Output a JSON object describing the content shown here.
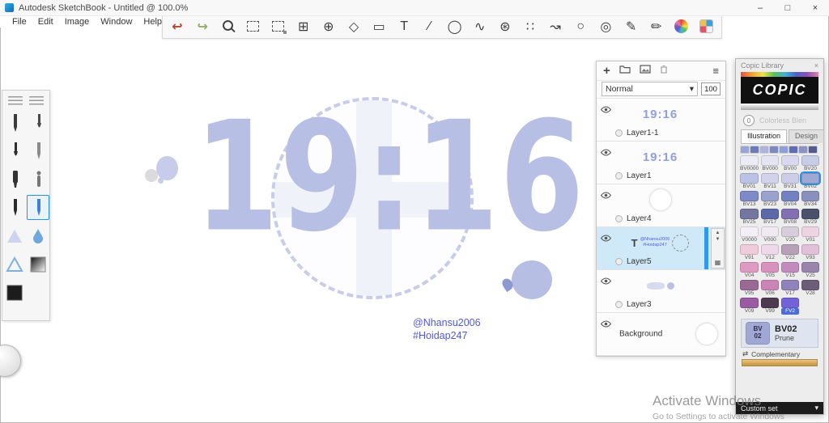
{
  "ui": {
    "caret": "▾",
    "menu_icon": "≡",
    "plus_icon": "+",
    "up_arrow": "▲",
    "down_arrow": "▼",
    "alpha_lock_icon": "▦",
    "complementary_icon": "⇄"
  },
  "window": {
    "title": "Autodesk SketchBook - Untitled @ 100.0%",
    "minimize": "–",
    "maximize": "□",
    "close": "×"
  },
  "menubar": {
    "items": [
      "File",
      "Edit",
      "Image",
      "Window",
      "Help"
    ]
  },
  "toolbar": {
    "tools": [
      {
        "name": "undo-icon",
        "glyph": "↩",
        "color": "#b5432f"
      },
      {
        "name": "redo-icon",
        "glyph": "↪",
        "color": "#8fae62"
      },
      {
        "name": "zoom-icon",
        "css": "zoom"
      },
      {
        "name": "rect-select-icon",
        "css": "dashbox"
      },
      {
        "name": "magic-select-icon",
        "css": "dashbox dot"
      },
      {
        "name": "crop-icon",
        "glyph": "⊞"
      },
      {
        "name": "transform-icon",
        "glyph": "⊕"
      },
      {
        "name": "polygon-select-icon",
        "glyph": "◇"
      },
      {
        "name": "distort-icon",
        "glyph": "▭"
      },
      {
        "name": "text-tool-icon",
        "glyph": "T"
      },
      {
        "name": "ruler-icon",
        "glyph": "∕"
      },
      {
        "name": "ellipse-guide-icon",
        "glyph": "◯"
      },
      {
        "name": "french-curve-icon",
        "glyph": "∿"
      },
      {
        "name": "perspective-icon",
        "glyph": "⊛"
      },
      {
        "name": "symmetry-icon",
        "glyph": "∷"
      },
      {
        "name": "steady-stroke-icon",
        "glyph": "↝"
      },
      {
        "name": "circle-tool-icon",
        "glyph": "○"
      },
      {
        "name": "ellipse-tool-icon",
        "glyph": "◎"
      },
      {
        "name": "pencil-set-icon",
        "glyph": "✎"
      },
      {
        "name": "brush-set-icon",
        "glyph": "✏"
      },
      {
        "name": "color-wheel-icon",
        "css": "colorwheel"
      },
      {
        "name": "swatch-grid-icon",
        "css": "swatchgrid"
      }
    ]
  },
  "brush_palette": {
    "brushes": [
      {
        "name": "pencil-brush",
        "shape": "pencil",
        "color": "#3b3b3b"
      },
      {
        "name": "paintbrush-brush",
        "shape": "brush",
        "color": "#4a4a4a"
      },
      {
        "name": "ink-brush",
        "shape": "brush",
        "color": "#2e2e2e"
      },
      {
        "name": "ballpoint-pen-brush",
        "shape": "pen",
        "color": "#8a8a8a"
      },
      {
        "name": "marker-brush",
        "shape": "marker",
        "color": "#333333"
      },
      {
        "name": "airbrush-brush",
        "shape": "airbrush",
        "color": "#777777"
      },
      {
        "name": "technical-pen-brush",
        "shape": "pen",
        "color": "#2b2b2b"
      },
      {
        "name": "glow-pen-brush",
        "shape": "pen",
        "color": "#3f7fd6",
        "selected": true
      },
      {
        "name": "smudge-brush",
        "shape": "triangle",
        "color": "#cdd5ee"
      },
      {
        "name": "water-drop-brush",
        "shape": "droplet",
        "color": "#6fa8dc"
      },
      {
        "name": "smear-brush",
        "shape": "triangleOutline",
        "color": "#7fb0e0"
      },
      {
        "name": "gradient-fill-tool",
        "shape": "gradient",
        "color": "#444444"
      },
      {
        "name": "solid-fill-tool",
        "shape": "square",
        "color": "#1c1c1c"
      }
    ]
  },
  "canvas": {
    "time_text": "19:16",
    "credit_line1": "@Nhansu2006",
    "credit_line2": "#Hoidap247"
  },
  "layers_panel": {
    "blend_mode": "Normal",
    "opacity": "100",
    "time_thumb_text": "19:16",
    "text_thumb_lines": [
      "@Nhansu2006",
      "#Hoidap247"
    ],
    "layers": [
      {
        "name": "Layer1-1",
        "thumb": "time"
      },
      {
        "name": "Layer1",
        "thumb": "time"
      },
      {
        "name": "Layer4",
        "thumb": "circle"
      },
      {
        "name": "Layer5",
        "thumb": "text",
        "selected": true
      },
      {
        "name": "Layer3",
        "thumb": "marks"
      },
      {
        "name": "Background",
        "thumb": "bgcircle"
      }
    ]
  },
  "copic_panel": {
    "title": "Copic Library",
    "close": "×",
    "logo": "COPIC",
    "colorless": {
      "number": "0",
      "label": "Colorless Blen"
    },
    "tabs": [
      {
        "label": "Illustration",
        "active": true
      },
      {
        "label": "Design",
        "active": false
      }
    ],
    "family_strip": [
      "#97a5d8",
      "#6e79b5",
      "#aab4de",
      "#7d88c0",
      "#8d9fd6",
      "#5f6db0",
      "#8a93c4",
      "#525c8e"
    ],
    "swatches": [
      {
        "code": "BV0000",
        "color": "#ececf6"
      },
      {
        "code": "BV000",
        "color": "#e5e4f2"
      },
      {
        "code": "BV00",
        "color": "#dad8ee"
      },
      {
        "code": "BV20",
        "color": "#c7cde6"
      },
      {
        "code": "BV01",
        "color": "#bcc2e4"
      },
      {
        "code": "BV11",
        "color": "#d2d2ea"
      },
      {
        "code": "BV31",
        "color": "#cccee8"
      },
      {
        "code": "BV02",
        "color": "#9fa7d5",
        "selected": true
      },
      {
        "code": "BV13",
        "color": "#7e8ac7"
      },
      {
        "code": "BV23",
        "color": "#99a2cd"
      },
      {
        "code": "BV04",
        "color": "#7381c0"
      },
      {
        "code": "BV34",
        "color": "#8a90bc"
      },
      {
        "code": "BV25",
        "color": "#73769f"
      },
      {
        "code": "BV17",
        "color": "#5d68aa"
      },
      {
        "code": "BV08",
        "color": "#8370b3"
      },
      {
        "code": "BV29",
        "color": "#4a526b"
      },
      {
        "code": "V0000",
        "color": "#f4eff6"
      },
      {
        "code": "V000",
        "color": "#f0e9f2"
      },
      {
        "code": "V20",
        "color": "#d7cddb"
      },
      {
        "code": "V01",
        "color": "#eed3e3"
      },
      {
        "code": "V91",
        "color": "#eeccd9"
      },
      {
        "code": "V12",
        "color": "#eed8e9"
      },
      {
        "code": "V22",
        "color": "#b8a1b8"
      },
      {
        "code": "V93",
        "color": "#e2c0dc"
      },
      {
        "code": "V04",
        "color": "#dd9bc2"
      },
      {
        "code": "V05",
        "color": "#d892bd"
      },
      {
        "code": "V15",
        "color": "#c28bbe"
      },
      {
        "code": "V25",
        "color": "#9b84ab"
      },
      {
        "code": "V95",
        "color": "#996a93"
      },
      {
        "code": "V06",
        "color": "#cb84b6"
      },
      {
        "code": "V17",
        "color": "#9082bb"
      },
      {
        "code": "V28",
        "color": "#6e5d78"
      },
      {
        "code": "V09",
        "color": "#9a5ba2"
      },
      {
        "code": "V99",
        "color": "#4d3a51"
      },
      {
        "code": "FV2",
        "color": "#7463d8",
        "fluorescent": true
      }
    ],
    "selected_color": {
      "code": "BV02",
      "code_line1": "BV",
      "code_line2": "02",
      "name": "Prune",
      "color": "#a0a7d4"
    },
    "complementary_label": "Complementary",
    "custom_set_label": "Custom set"
  },
  "watermark": {
    "line1": "Activate Windows",
    "line2": "Go to Settings to activate Windows"
  }
}
